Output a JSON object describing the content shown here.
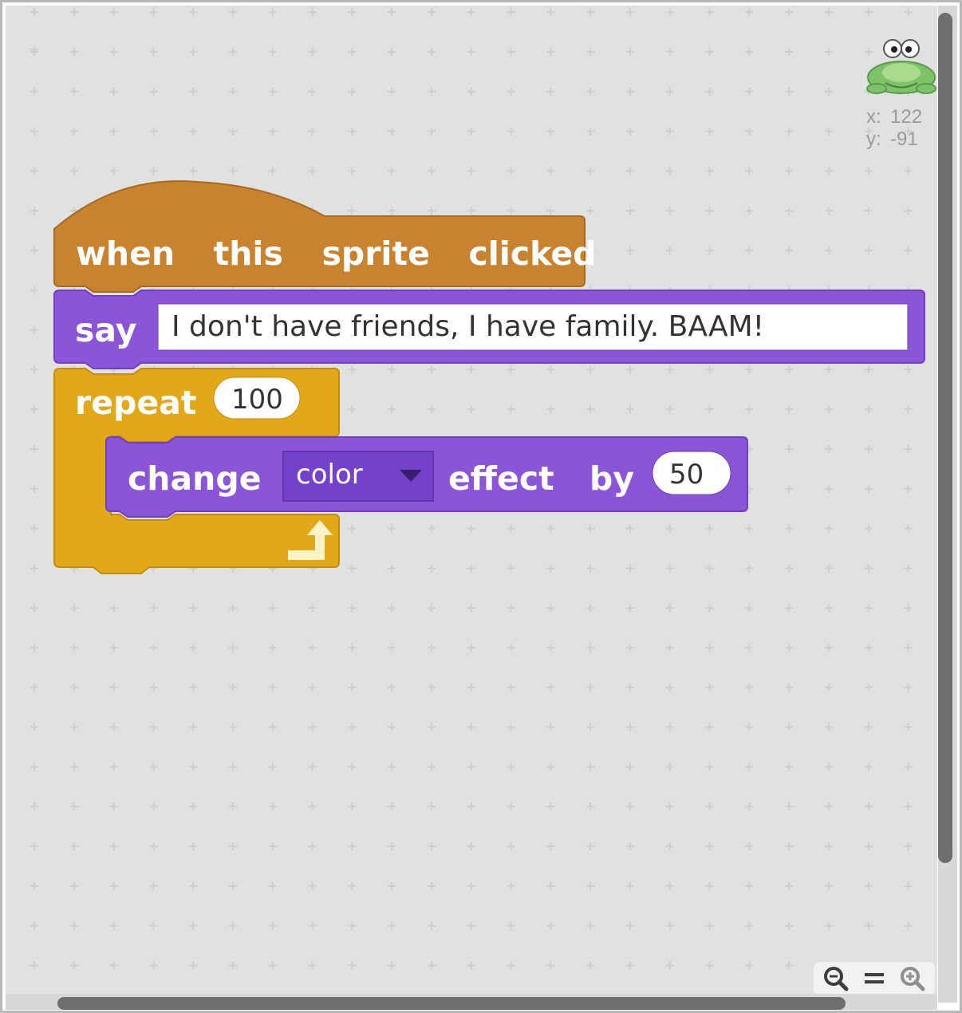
{
  "sprite": {
    "coords": {
      "x_label": "x:",
      "x_value": "122",
      "y_label": "y:",
      "y_value": "-91"
    }
  },
  "script": {
    "hat": {
      "words": [
        "when",
        "this",
        "sprite",
        "clicked"
      ]
    },
    "say": {
      "label": "say",
      "message": "I don't have friends, I have family. BAAM!"
    },
    "repeat": {
      "label": "repeat",
      "count": "100"
    },
    "change_effect": {
      "label": "change",
      "effect": "color",
      "effect_label": "effect",
      "by_label": "by",
      "amount": "50"
    }
  },
  "colors": {
    "events": "#c88330",
    "looks": "#8a55d7",
    "control": "#e1a91a",
    "workspace": "#e0e1e1",
    "scrollbar": "#6e6e70"
  },
  "zoom_controls": [
    "zoom-out-icon",
    "zoom-reset-icon",
    "zoom-in-icon"
  ]
}
